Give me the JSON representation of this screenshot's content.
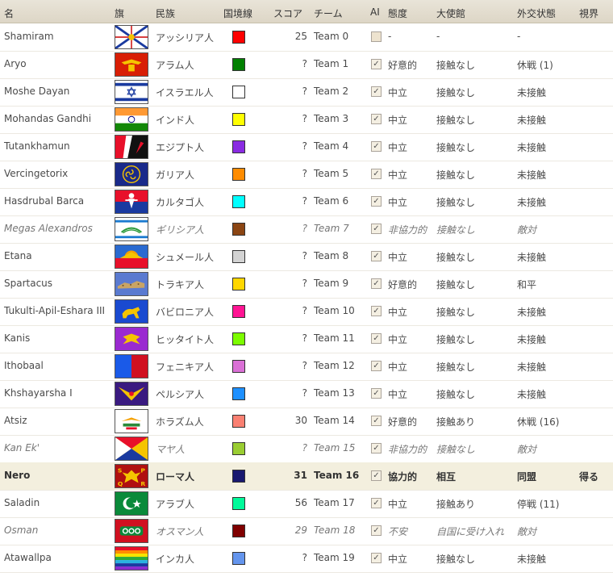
{
  "headers": {
    "name": "名",
    "flag": "旗",
    "nation": "民族",
    "border": "国境線",
    "score": "スコア",
    "team": "チーム",
    "ai": "AI",
    "attitude": "態度",
    "embassy": "大使館",
    "diplo": "外交状態",
    "vision": "視界"
  },
  "check_glyph": "✓",
  "players": [
    {
      "name": "Shamiram",
      "nation": "アッシリア人",
      "color": "#ff0000",
      "score": "25",
      "team": "Team 0",
      "ai": false,
      "attitude": "-",
      "embassy": "-",
      "diplo": "-",
      "vision": "",
      "flag": "assyria",
      "style": ""
    },
    {
      "name": "Aryo",
      "nation": "アラム人",
      "color": "#008000",
      "score": "?",
      "team": "Team 1",
      "ai": true,
      "attitude": "好意的",
      "embassy": "接触なし",
      "diplo": "休戦 (1)",
      "vision": "",
      "flag": "aram",
      "style": ""
    },
    {
      "name": "Moshe Dayan",
      "nation": "イスラエル人",
      "color": "#ffffff",
      "score": "?",
      "team": "Team 2",
      "ai": true,
      "attitude": "中立",
      "embassy": "接触なし",
      "diplo": "未接触",
      "vision": "",
      "flag": "israel",
      "style": ""
    },
    {
      "name": "Mohandas Gandhi",
      "nation": "インド人",
      "color": "#ffff00",
      "score": "?",
      "team": "Team 3",
      "ai": true,
      "attitude": "中立",
      "embassy": "接触なし",
      "diplo": "未接触",
      "vision": "",
      "flag": "india",
      "style": ""
    },
    {
      "name": "Tutankhamun",
      "nation": "エジプト人",
      "color": "#8a2be2",
      "score": "?",
      "team": "Team 4",
      "ai": true,
      "attitude": "中立",
      "embassy": "接触なし",
      "diplo": "未接触",
      "vision": "",
      "flag": "egypt",
      "style": ""
    },
    {
      "name": "Vercingetorix",
      "nation": "ガリア人",
      "color": "#ff8c00",
      "score": "?",
      "team": "Team 5",
      "ai": true,
      "attitude": "中立",
      "embassy": "接触なし",
      "diplo": "未接触",
      "vision": "",
      "flag": "gaul",
      "style": ""
    },
    {
      "name": "Hasdrubal Barca",
      "nation": "カルタゴ人",
      "color": "#00ffff",
      "score": "?",
      "team": "Team 6",
      "ai": true,
      "attitude": "中立",
      "embassy": "接触なし",
      "diplo": "未接触",
      "vision": "",
      "flag": "carthage",
      "style": ""
    },
    {
      "name": "Megas Alexandros",
      "nation": "ギリシア人",
      "color": "#8b4513",
      "score": "?",
      "team": "Team 7",
      "ai": true,
      "attitude": "非協力的",
      "embassy": "接触なし",
      "diplo": "敵対",
      "vision": "",
      "flag": "greece",
      "style": "italic"
    },
    {
      "name": "Etana",
      "nation": "シュメール人",
      "color": "#d3d3d3",
      "score": "?",
      "team": "Team 8",
      "ai": true,
      "attitude": "中立",
      "embassy": "接触なし",
      "diplo": "未接触",
      "vision": "",
      "flag": "sumer",
      "style": ""
    },
    {
      "name": "Spartacus",
      "nation": "トラキア人",
      "color": "#ffd700",
      "score": "?",
      "team": "Team 9",
      "ai": true,
      "attitude": "好意的",
      "embassy": "接触なし",
      "diplo": "和平",
      "vision": "",
      "flag": "thrace",
      "style": ""
    },
    {
      "name": "Tukulti-Apil-Eshara III",
      "nation": "バビロニア人",
      "color": "#ff1493",
      "score": "?",
      "team": "Team 10",
      "ai": true,
      "attitude": "中立",
      "embassy": "接触なし",
      "diplo": "未接触",
      "vision": "",
      "flag": "babylon",
      "style": ""
    },
    {
      "name": "Kanis",
      "nation": "ヒッタイト人",
      "color": "#7cfc00",
      "score": "?",
      "team": "Team 11",
      "ai": true,
      "attitude": "中立",
      "embassy": "接触なし",
      "diplo": "未接触",
      "vision": "",
      "flag": "hittite",
      "style": ""
    },
    {
      "name": "Ithobaal",
      "nation": "フェニキア人",
      "color": "#da70d6",
      "score": "?",
      "team": "Team 12",
      "ai": true,
      "attitude": "中立",
      "embassy": "接触なし",
      "diplo": "未接触",
      "vision": "",
      "flag": "phoenicia",
      "style": ""
    },
    {
      "name": "Khshayarsha I",
      "nation": "ペルシア人",
      "color": "#1e90ff",
      "score": "?",
      "team": "Team 13",
      "ai": true,
      "attitude": "中立",
      "embassy": "接触なし",
      "diplo": "未接触",
      "vision": "",
      "flag": "persia",
      "style": ""
    },
    {
      "name": "Atsiz",
      "nation": "ホラズム人",
      "color": "#fa8072",
      "score": "30",
      "team": "Team 14",
      "ai": true,
      "attitude": "好意的",
      "embassy": "接触あり",
      "diplo": "休戦 (16)",
      "vision": "",
      "flag": "khwarezm",
      "style": ""
    },
    {
      "name": "Kan Ek'",
      "nation": "マヤ人",
      "color": "#9acd32",
      "score": "?",
      "team": "Team 15",
      "ai": true,
      "attitude": "非協力的",
      "embassy": "接触なし",
      "diplo": "敵対",
      "vision": "",
      "flag": "maya",
      "style": "italic"
    },
    {
      "name": "Nero",
      "nation": "ローマ人",
      "color": "#191970",
      "score": "31",
      "team": "Team 16",
      "ai": true,
      "attitude": "協力的",
      "embassy": "相互",
      "diplo": "同盟",
      "vision": "得る",
      "flag": "rome",
      "style": "bold"
    },
    {
      "name": "Saladin",
      "nation": "アラブ人",
      "color": "#00fa9a",
      "score": "56",
      "team": "Team 17",
      "ai": true,
      "attitude": "中立",
      "embassy": "接触あり",
      "diplo": "停戦 (11)",
      "vision": "",
      "flag": "arab",
      "style": ""
    },
    {
      "name": "Osman",
      "nation": "オスマン人",
      "color": "#800000",
      "score": "29",
      "team": "Team 18",
      "ai": true,
      "attitude": "不安",
      "embassy": "自国に受け入れ",
      "diplo": "敵対",
      "vision": "",
      "flag": "ottoman",
      "style": "italic"
    },
    {
      "name": "Atawallpa",
      "nation": "インカ人",
      "color": "#6495ed",
      "score": "?",
      "team": "Team 19",
      "ai": true,
      "attitude": "中立",
      "embassy": "接触なし",
      "diplo": "未接触",
      "vision": "",
      "flag": "inca",
      "style": ""
    }
  ]
}
